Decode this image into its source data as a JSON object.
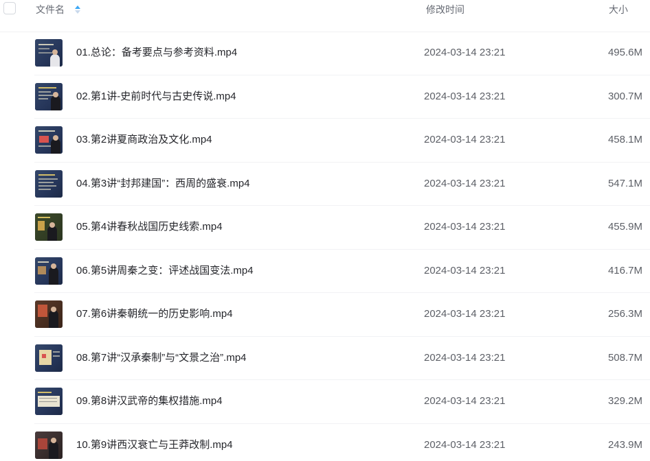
{
  "header": {
    "name_label": "文件名",
    "mtime_label": "修改时间",
    "size_label": "大小",
    "sort_icon": "sort-ascending-icon"
  },
  "colors": {
    "sort_active": "#3da8f5",
    "sort_inactive": "#c9d9ec",
    "thumb_bg": "#2d3d5c"
  },
  "files": [
    {
      "name": "01.总论：备考要点与参考资料.mp4",
      "mtime": "2024-03-14 23:21",
      "size": "495.6M"
    },
    {
      "name": "02.第1讲-史前时代与古史传说.mp4",
      "mtime": "2024-03-14 23:21",
      "size": "300.7M"
    },
    {
      "name": "03.第2讲夏商政治及文化.mp4",
      "mtime": "2024-03-14 23:21",
      "size": "458.1M"
    },
    {
      "name": "04.第3讲“封邦建国”：西周的盛衰.mp4",
      "mtime": "2024-03-14 23:21",
      "size": "547.1M"
    },
    {
      "name": "05.第4讲春秋战国历史线索.mp4",
      "mtime": "2024-03-14 23:21",
      "size": "455.9M"
    },
    {
      "name": "06.第5讲周秦之变：评述战国变法.mp4",
      "mtime": "2024-03-14 23:21",
      "size": "416.7M"
    },
    {
      "name": "07.第6讲秦朝统一的历史影响.mp4",
      "mtime": "2024-03-14 23:21",
      "size": "256.3M"
    },
    {
      "name": "08.第7讲“汉承秦制”与“文景之治”.mp4",
      "mtime": "2024-03-14 23:21",
      "size": "508.7M"
    },
    {
      "name": "09.第8讲汉武帝的集权措施.mp4",
      "mtime": "2024-03-14 23:21",
      "size": "329.2M"
    },
    {
      "name": "10.第9讲西汉衰亡与王莽改制.mp4",
      "mtime": "2024-03-14 23:21",
      "size": "243.9M"
    }
  ]
}
